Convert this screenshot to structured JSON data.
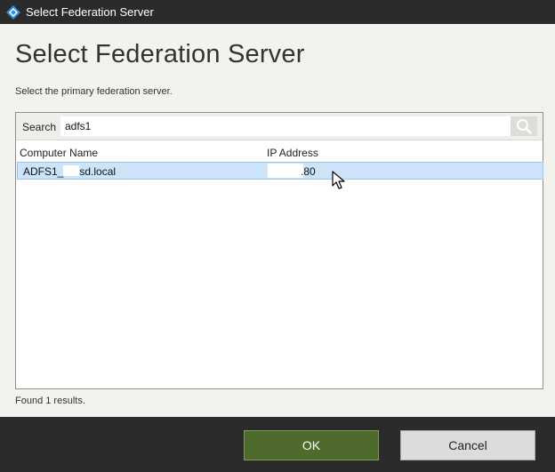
{
  "window": {
    "title": "Select Federation Server"
  },
  "page": {
    "heading": "Select Federation Server",
    "subtitle": "Select the primary federation server."
  },
  "search": {
    "label": "Search",
    "value": "adfs1",
    "placeholder": ""
  },
  "table": {
    "columns": [
      "Computer Name",
      "IP Address"
    ],
    "rows": [
      {
        "computer_name_prefix": "ADFS1_",
        "computer_name_suffix": "sd.local",
        "ip_address_visible": ".80",
        "selected": true
      }
    ]
  },
  "status": {
    "text": "Found 1 results."
  },
  "buttons": {
    "ok_label": "OK",
    "cancel_label": "Cancel"
  },
  "colors": {
    "accent_ok": "#4e6a2c",
    "selection": "#cde3f7",
    "titlebar": "#2b2b2b"
  },
  "icons": {
    "app": "adfs-app-icon",
    "search": "search-icon",
    "cursor": "mouse-cursor-icon"
  }
}
